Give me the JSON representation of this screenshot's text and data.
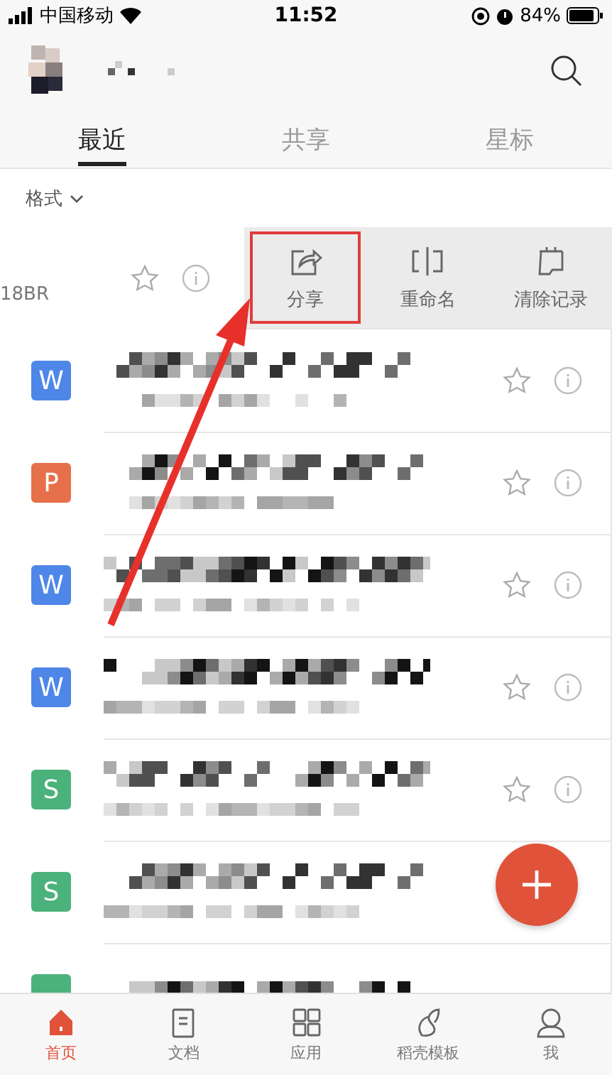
{
  "status_bar": {
    "carrier": "中国移动",
    "time": "11:52",
    "battery": "84%"
  },
  "tabs": [
    {
      "label": "最近",
      "selected": true
    },
    {
      "label": "共享",
      "selected": false
    },
    {
      "label": "星标",
      "selected": false
    }
  ],
  "filter": {
    "label": "格式"
  },
  "swiped_row": {
    "fragment": "18BR",
    "starred": false,
    "actions": [
      {
        "kind": "share",
        "label": "分享",
        "highlighted": true
      },
      {
        "kind": "rename",
        "label": "重命名",
        "highlighted": false
      },
      {
        "kind": "clear",
        "label": "清除记录",
        "highlighted": false
      }
    ]
  },
  "files": [
    {
      "letter": "W",
      "color": "#4f87e8",
      "starred": false
    },
    {
      "letter": "P",
      "color": "#e6704a",
      "starred": false
    },
    {
      "letter": "W",
      "color": "#4f87e8",
      "starred": false
    },
    {
      "letter": "W",
      "color": "#4f87e8",
      "starred": false
    },
    {
      "letter": "S",
      "color": "#4cb27b",
      "starred": false
    },
    {
      "letter": "S",
      "color": "#4cb27b"
    },
    {
      "color": "#4cb27b"
    }
  ],
  "nav": [
    {
      "kind": "home",
      "label": "首页",
      "selected": true
    },
    {
      "kind": "docs",
      "label": "文档",
      "selected": false
    },
    {
      "kind": "apps",
      "label": "应用",
      "selected": false
    },
    {
      "kind": "templates",
      "label": "稻壳模板",
      "selected": false
    },
    {
      "kind": "me",
      "label": "我",
      "selected": false
    }
  ]
}
